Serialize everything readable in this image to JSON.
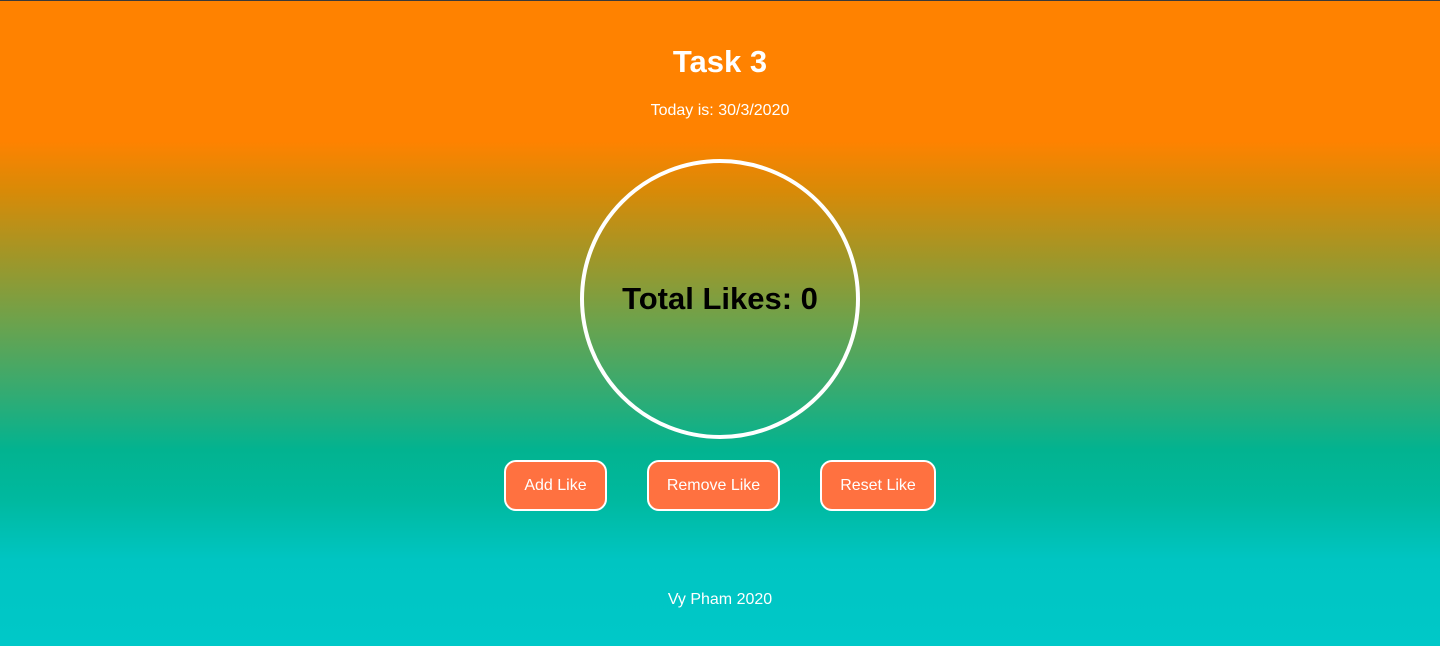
{
  "header": {
    "title": "Task 3",
    "date_text": "Today is: 30/3/2020"
  },
  "likes": {
    "label": "Total Likes: 0",
    "count": 0
  },
  "actions": {
    "add_label": "Add Like",
    "remove_label": "Remove Like",
    "reset_label": "Reset Like"
  },
  "footer": {
    "text": "Vy Pham 2020"
  },
  "colors": {
    "gradient_top": "#ff8200",
    "gradient_bottom": "#00c8c8",
    "button_fill": "#ff7140",
    "button_border": "#ffffff",
    "circle_border": "#ffffff",
    "text_light": "#ffffff",
    "text_dark": "#000000"
  }
}
